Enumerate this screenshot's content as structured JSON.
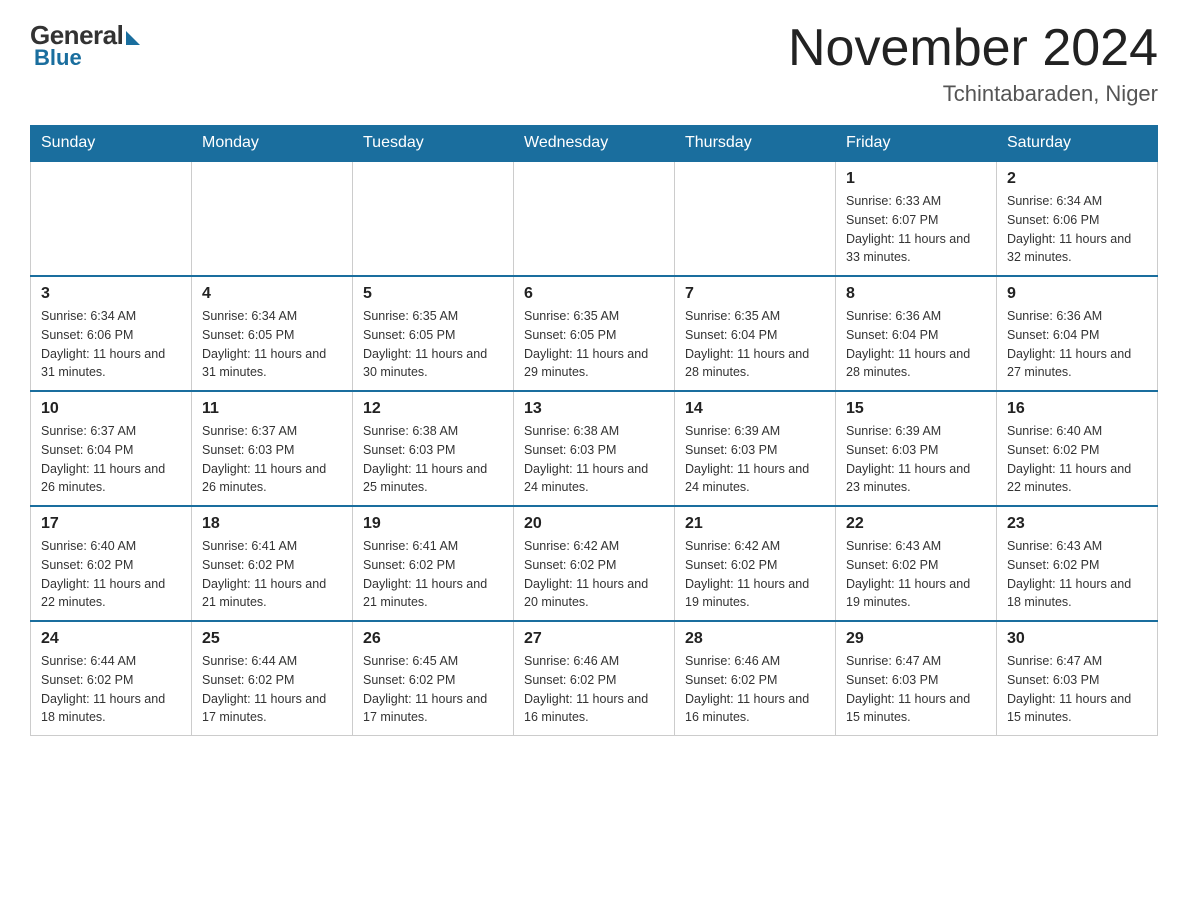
{
  "logo": {
    "general": "General",
    "blue": "Blue"
  },
  "title": "November 2024",
  "subtitle": "Tchintabaraden, Niger",
  "weekdays": [
    "Sunday",
    "Monday",
    "Tuesday",
    "Wednesday",
    "Thursday",
    "Friday",
    "Saturday"
  ],
  "weeks": [
    [
      {
        "day": "",
        "info": ""
      },
      {
        "day": "",
        "info": ""
      },
      {
        "day": "",
        "info": ""
      },
      {
        "day": "",
        "info": ""
      },
      {
        "day": "",
        "info": ""
      },
      {
        "day": "1",
        "info": "Sunrise: 6:33 AM\nSunset: 6:07 PM\nDaylight: 11 hours and 33 minutes."
      },
      {
        "day": "2",
        "info": "Sunrise: 6:34 AM\nSunset: 6:06 PM\nDaylight: 11 hours and 32 minutes."
      }
    ],
    [
      {
        "day": "3",
        "info": "Sunrise: 6:34 AM\nSunset: 6:06 PM\nDaylight: 11 hours and 31 minutes."
      },
      {
        "day": "4",
        "info": "Sunrise: 6:34 AM\nSunset: 6:05 PM\nDaylight: 11 hours and 31 minutes."
      },
      {
        "day": "5",
        "info": "Sunrise: 6:35 AM\nSunset: 6:05 PM\nDaylight: 11 hours and 30 minutes."
      },
      {
        "day": "6",
        "info": "Sunrise: 6:35 AM\nSunset: 6:05 PM\nDaylight: 11 hours and 29 minutes."
      },
      {
        "day": "7",
        "info": "Sunrise: 6:35 AM\nSunset: 6:04 PM\nDaylight: 11 hours and 28 minutes."
      },
      {
        "day": "8",
        "info": "Sunrise: 6:36 AM\nSunset: 6:04 PM\nDaylight: 11 hours and 28 minutes."
      },
      {
        "day": "9",
        "info": "Sunrise: 6:36 AM\nSunset: 6:04 PM\nDaylight: 11 hours and 27 minutes."
      }
    ],
    [
      {
        "day": "10",
        "info": "Sunrise: 6:37 AM\nSunset: 6:04 PM\nDaylight: 11 hours and 26 minutes."
      },
      {
        "day": "11",
        "info": "Sunrise: 6:37 AM\nSunset: 6:03 PM\nDaylight: 11 hours and 26 minutes."
      },
      {
        "day": "12",
        "info": "Sunrise: 6:38 AM\nSunset: 6:03 PM\nDaylight: 11 hours and 25 minutes."
      },
      {
        "day": "13",
        "info": "Sunrise: 6:38 AM\nSunset: 6:03 PM\nDaylight: 11 hours and 24 minutes."
      },
      {
        "day": "14",
        "info": "Sunrise: 6:39 AM\nSunset: 6:03 PM\nDaylight: 11 hours and 24 minutes."
      },
      {
        "day": "15",
        "info": "Sunrise: 6:39 AM\nSunset: 6:03 PM\nDaylight: 11 hours and 23 minutes."
      },
      {
        "day": "16",
        "info": "Sunrise: 6:40 AM\nSunset: 6:02 PM\nDaylight: 11 hours and 22 minutes."
      }
    ],
    [
      {
        "day": "17",
        "info": "Sunrise: 6:40 AM\nSunset: 6:02 PM\nDaylight: 11 hours and 22 minutes."
      },
      {
        "day": "18",
        "info": "Sunrise: 6:41 AM\nSunset: 6:02 PM\nDaylight: 11 hours and 21 minutes."
      },
      {
        "day": "19",
        "info": "Sunrise: 6:41 AM\nSunset: 6:02 PM\nDaylight: 11 hours and 21 minutes."
      },
      {
        "day": "20",
        "info": "Sunrise: 6:42 AM\nSunset: 6:02 PM\nDaylight: 11 hours and 20 minutes."
      },
      {
        "day": "21",
        "info": "Sunrise: 6:42 AM\nSunset: 6:02 PM\nDaylight: 11 hours and 19 minutes."
      },
      {
        "day": "22",
        "info": "Sunrise: 6:43 AM\nSunset: 6:02 PM\nDaylight: 11 hours and 19 minutes."
      },
      {
        "day": "23",
        "info": "Sunrise: 6:43 AM\nSunset: 6:02 PM\nDaylight: 11 hours and 18 minutes."
      }
    ],
    [
      {
        "day": "24",
        "info": "Sunrise: 6:44 AM\nSunset: 6:02 PM\nDaylight: 11 hours and 18 minutes."
      },
      {
        "day": "25",
        "info": "Sunrise: 6:44 AM\nSunset: 6:02 PM\nDaylight: 11 hours and 17 minutes."
      },
      {
        "day": "26",
        "info": "Sunrise: 6:45 AM\nSunset: 6:02 PM\nDaylight: 11 hours and 17 minutes."
      },
      {
        "day": "27",
        "info": "Sunrise: 6:46 AM\nSunset: 6:02 PM\nDaylight: 11 hours and 16 minutes."
      },
      {
        "day": "28",
        "info": "Sunrise: 6:46 AM\nSunset: 6:02 PM\nDaylight: 11 hours and 16 minutes."
      },
      {
        "day": "29",
        "info": "Sunrise: 6:47 AM\nSunset: 6:03 PM\nDaylight: 11 hours and 15 minutes."
      },
      {
        "day": "30",
        "info": "Sunrise: 6:47 AM\nSunset: 6:03 PM\nDaylight: 11 hours and 15 minutes."
      }
    ]
  ]
}
